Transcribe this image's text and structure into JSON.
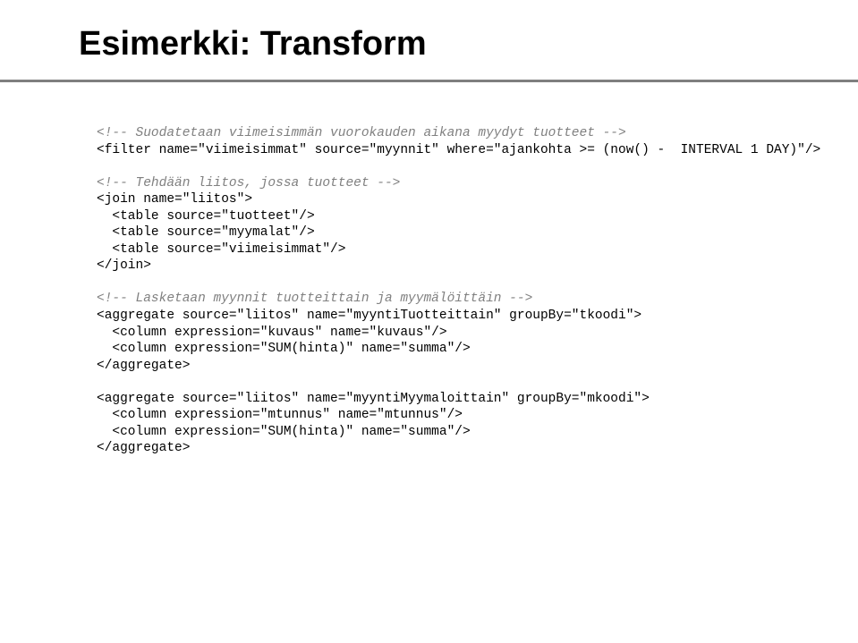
{
  "title": "Esimerkki: Transform",
  "code": {
    "c1": "<!-- Suodatetaan viimeisimmän vuorokauden aikana myydyt tuotteet -->",
    "l1": "<filter name=\"viimeisimmat\" source=\"myynnit\" where=\"ajankohta >= (now() -  INTERVAL 1 DAY)\"/>",
    "c2": "<!-- Tehdään liitos, jossa tuotteet -->",
    "l2": "<join name=\"liitos\">",
    "l3": "  <table source=\"tuotteet\"/>",
    "l4": "  <table source=\"myymalat\"/>",
    "l5": "  <table source=\"viimeisimmat\"/>",
    "l6": "</join>",
    "c3": "<!-- Lasketaan myynnit tuotteittain ja myymälöittäin -->",
    "l7": "<aggregate source=\"liitos\" name=\"myyntiTuotteittain\" groupBy=\"tkoodi\">",
    "l8": "  <column expression=\"kuvaus\" name=\"kuvaus\"/>",
    "l9": "  <column expression=\"SUM(hinta)\" name=\"summa\"/>",
    "l10": "</aggregate>",
    "l11": "<aggregate source=\"liitos\" name=\"myyntiMyymaloittain\" groupBy=\"mkoodi\">",
    "l12": "  <column expression=\"mtunnus\" name=\"mtunnus\"/>",
    "l13": "  <column expression=\"SUM(hinta)\" name=\"summa\"/>",
    "l14": "</aggregate>"
  }
}
